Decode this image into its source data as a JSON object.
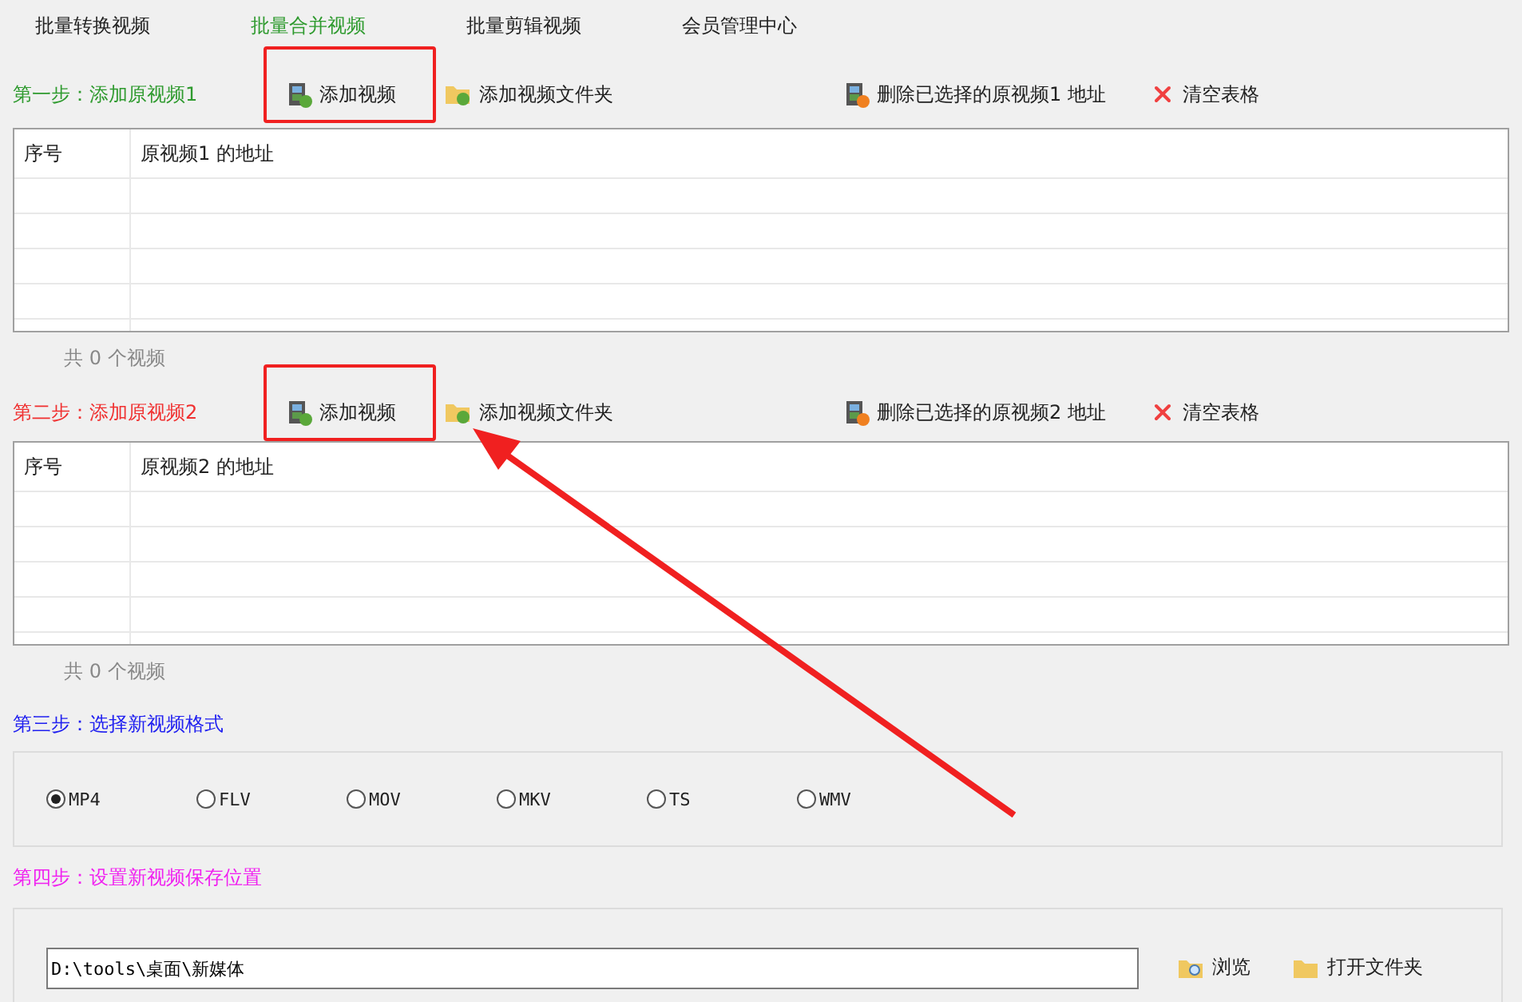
{
  "tabs": [
    {
      "label": "批量转换视频",
      "selected": false
    },
    {
      "label": "批量合并视频",
      "selected": true
    },
    {
      "label": "批量剪辑视频",
      "selected": false
    },
    {
      "label": "会员管理中心",
      "selected": false
    }
  ],
  "steps": [
    {
      "kind": "videos",
      "title": "第一步：添加原视频1",
      "color": "#2e9a2e",
      "buttons": [
        {
          "kind": "add-video",
          "label": "添加视频",
          "highlighted": true
        },
        {
          "kind": "add-folder",
          "label": "添加视频文件夹",
          "highlighted": false
        },
        {
          "kind": "delete",
          "label": "删除已选择的原视频1 地址",
          "highlighted": false
        },
        {
          "kind": "clear",
          "label": "清空表格",
          "highlighted": false
        }
      ],
      "columns": [
        "序号",
        "原视频1 的地址"
      ],
      "count": "共 0 个视频"
    },
    {
      "kind": "videos",
      "title": "第二步：添加原视频2",
      "color": "#f03030",
      "buttons": [
        {
          "kind": "add-video",
          "label": "添加视频",
          "highlighted": true
        },
        {
          "kind": "add-folder",
          "label": "添加视频文件夹",
          "highlighted": false
        },
        {
          "kind": "delete",
          "label": "删除已选择的原视频2 地址",
          "highlighted": false
        },
        {
          "kind": "clear",
          "label": "清空表格",
          "highlighted": false
        }
      ],
      "columns": [
        "序号",
        "原视频2 的地址"
      ],
      "count": "共 0 个视频"
    },
    {
      "kind": "formats",
      "title": "第三步：选择新视频格式",
      "color": "#2020f0",
      "options": [
        {
          "label": "MP4",
          "selected": true
        },
        {
          "label": "FLV",
          "selected": false
        },
        {
          "label": "MOV",
          "selected": false
        },
        {
          "label": "MKV",
          "selected": false
        },
        {
          "label": "TS",
          "selected": false
        },
        {
          "label": "WMV",
          "selected": false
        }
      ]
    },
    {
      "kind": "output",
      "title": "第四步：设置新视频保存位置",
      "color": "#f020f0",
      "path": "D:\\tools\\桌面\\新媒体",
      "buttons": [
        {
          "kind": "browse",
          "label": "浏览"
        },
        {
          "kind": "open-folder",
          "label": "打开文件夹"
        }
      ]
    }
  ]
}
